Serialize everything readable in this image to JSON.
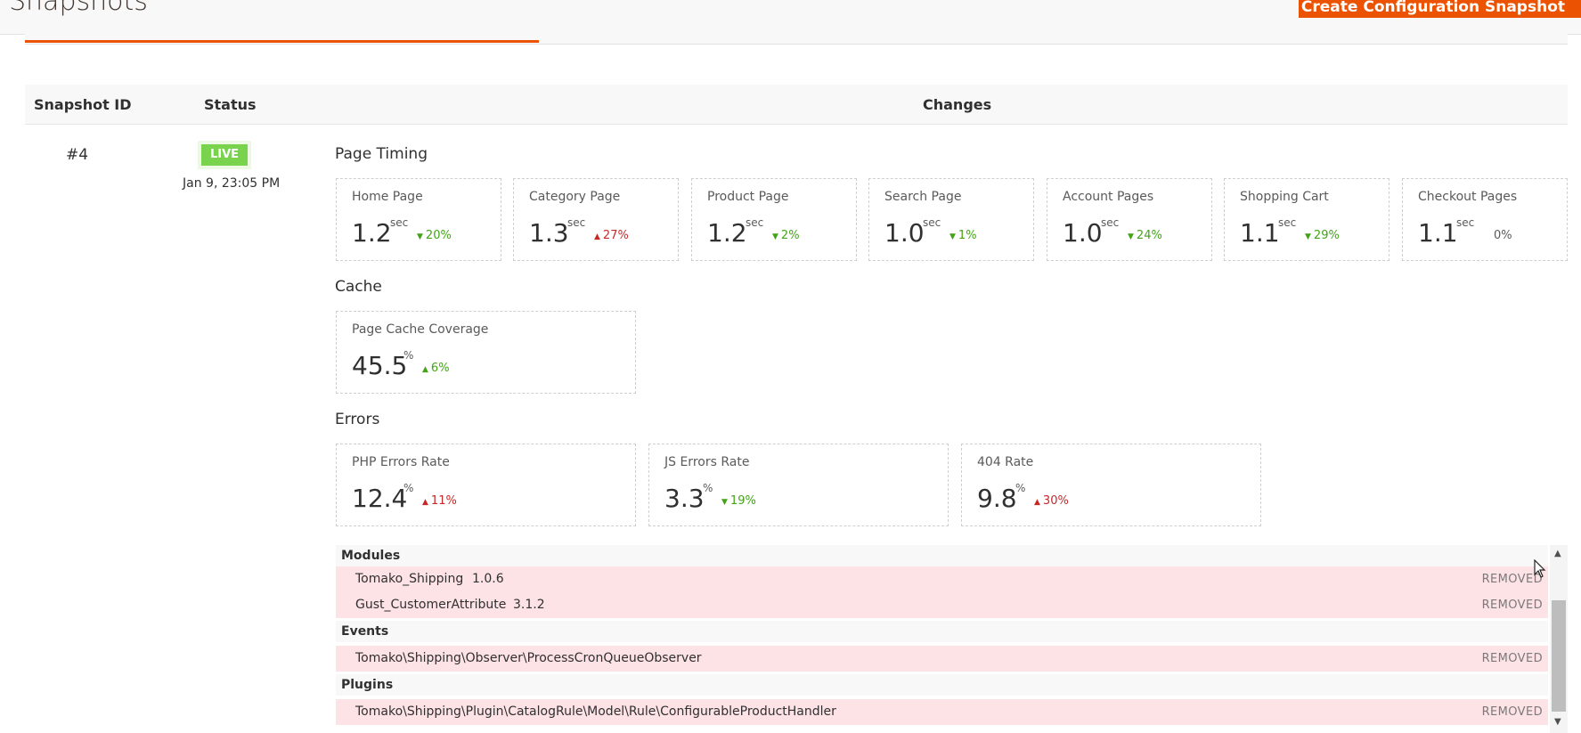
{
  "header": {
    "title": "Snapshots",
    "create_button": "Create Configuration Snapshot"
  },
  "table": {
    "columns": {
      "snapshot_id": "Snapshot ID",
      "status": "Status",
      "changes": "Changes"
    },
    "row": {
      "id": "#4",
      "status": "LIVE",
      "date": "Jan 9, 23:05 PM"
    }
  },
  "sections": {
    "page_timing": "Page Timing",
    "cache": "Cache",
    "errors": "Errors"
  },
  "page_timing": [
    {
      "label": "Home Page",
      "value": "1.2",
      "unit": "sec",
      "delta": "20",
      "delta_unit": "%",
      "direction": "down"
    },
    {
      "label": "Category Page",
      "value": "1.3",
      "unit": "sec",
      "delta": "27",
      "delta_unit": "%",
      "direction": "up"
    },
    {
      "label": "Product Page",
      "value": "1.2",
      "unit": "sec",
      "delta": "2",
      "delta_unit": "%",
      "direction": "down"
    },
    {
      "label": "Search Page",
      "value": "1.0",
      "unit": "sec",
      "delta": "1",
      "delta_unit": "%",
      "direction": "down"
    },
    {
      "label": "Account Pages",
      "value": "1.0",
      "unit": "sec",
      "delta": "24",
      "delta_unit": "%",
      "direction": "down"
    },
    {
      "label": "Shopping Cart",
      "value": "1.1",
      "unit": "sec",
      "delta": "29",
      "delta_unit": "%",
      "direction": "down"
    },
    {
      "label": "Checkout Pages",
      "value": "1.1",
      "unit": "sec",
      "delta": "0",
      "delta_unit": "%",
      "direction": "flat"
    }
  ],
  "cache": [
    {
      "label": "Page Cache Coverage",
      "value": "45.5",
      "unit": "%",
      "delta": "6",
      "delta_unit": "%",
      "direction": "up-good"
    }
  ],
  "errors": [
    {
      "label": "PHP Errors Rate",
      "value": "12.4",
      "unit": "%",
      "delta": "11",
      "delta_unit": "%",
      "direction": "up"
    },
    {
      "label": "JS Errors Rate",
      "value": "3.3",
      "unit": "%",
      "delta": "19",
      "delta_unit": "%",
      "direction": "down"
    },
    {
      "label": "404 Rate",
      "value": "9.8",
      "unit": "%",
      "delta": "30",
      "delta_unit": "%",
      "direction": "up"
    }
  ],
  "changes": {
    "modules_title": "Modules",
    "modules": [
      {
        "name": "Tomako_Shipping",
        "version": "1.0.6",
        "state": "REMOVED"
      },
      {
        "name": "Gust_CustomerAttribute",
        "version": "3.1.2",
        "state": "REMOVED"
      }
    ],
    "events_title": "Events",
    "events": [
      {
        "name": "Tomako\\Shipping\\Observer\\ProcessCronQueueObserver",
        "state": "REMOVED"
      }
    ],
    "plugins_title": "Plugins",
    "plugins": [
      {
        "name": "Tomako\\Shipping\\Plugin\\CatalogRule\\Model\\Rule\\ConfigurableProductHandler",
        "state": "REMOVED"
      }
    ]
  },
  "glyphs": {
    "arrow_down": "▼",
    "arrow_up": "▲",
    "scroll_up": "▲",
    "scroll_down": "▼"
  },
  "colors": {
    "accent": "#eb5202",
    "live": "#79d34c",
    "good": "#43a316",
    "bad": "#c62828",
    "removed_bg": "#fde2e6"
  }
}
